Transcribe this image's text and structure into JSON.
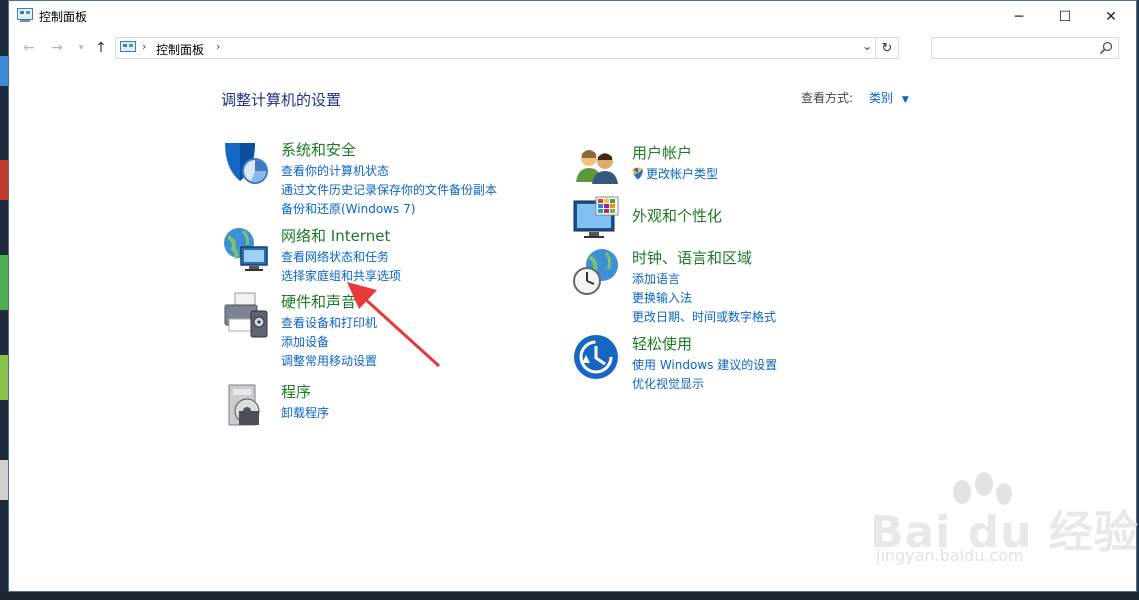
{
  "window": {
    "title": "控制面板",
    "controls": {
      "minimize": "─",
      "maximize": "☐",
      "close": "✕"
    }
  },
  "address": {
    "crumb": "控制面板",
    "search_placeholder": ""
  },
  "content": {
    "heading": "调整计算机的设置",
    "view_by_label": "查看方式:",
    "view_by_value": "类别"
  },
  "categories": {
    "system": {
      "title": "系统和安全",
      "links": [
        "查看你的计算机状态",
        "通过文件历史记录保存你的文件备份副本",
        "备份和还原(Windows 7)"
      ],
      "icon": "shield-icon"
    },
    "network": {
      "title": "网络和 Internet",
      "links": [
        "查看网络状态和任务",
        "选择家庭组和共享选项"
      ],
      "icon": "globe-network-icon"
    },
    "hardware": {
      "title": "硬件和声音",
      "links": [
        "查看设备和打印机",
        "添加设备",
        "调整常用移动设置"
      ],
      "icon": "printer-icon"
    },
    "programs": {
      "title": "程序",
      "links": [
        "卸载程序"
      ],
      "icon": "programs-disc-icon"
    },
    "users": {
      "title": "用户帐户",
      "links": [
        "更改帐户类型"
      ],
      "icon": "users-icon"
    },
    "appearance": {
      "title": "外观和个性化",
      "links": [],
      "icon": "monitor-palette-icon"
    },
    "clock": {
      "title": "时钟、语言和区域",
      "links": [
        "添加语言",
        "更换输入法",
        "更改日期、时间或数字格式"
      ],
      "icon": "clock-globe-icon"
    },
    "ease": {
      "title": "轻松使用",
      "links": [
        "使用 Windows 建议的设置",
        "优化视觉显示"
      ],
      "icon": "ease-of-access-icon"
    }
  },
  "watermark": {
    "brand": "Bai du 经验",
    "url": "jingyan.baidu.com"
  },
  "colors": {
    "heading": "#1e3287",
    "category_title": "#1c7a25",
    "link": "#0a64c8",
    "annotation_arrow": "#e8383a"
  }
}
